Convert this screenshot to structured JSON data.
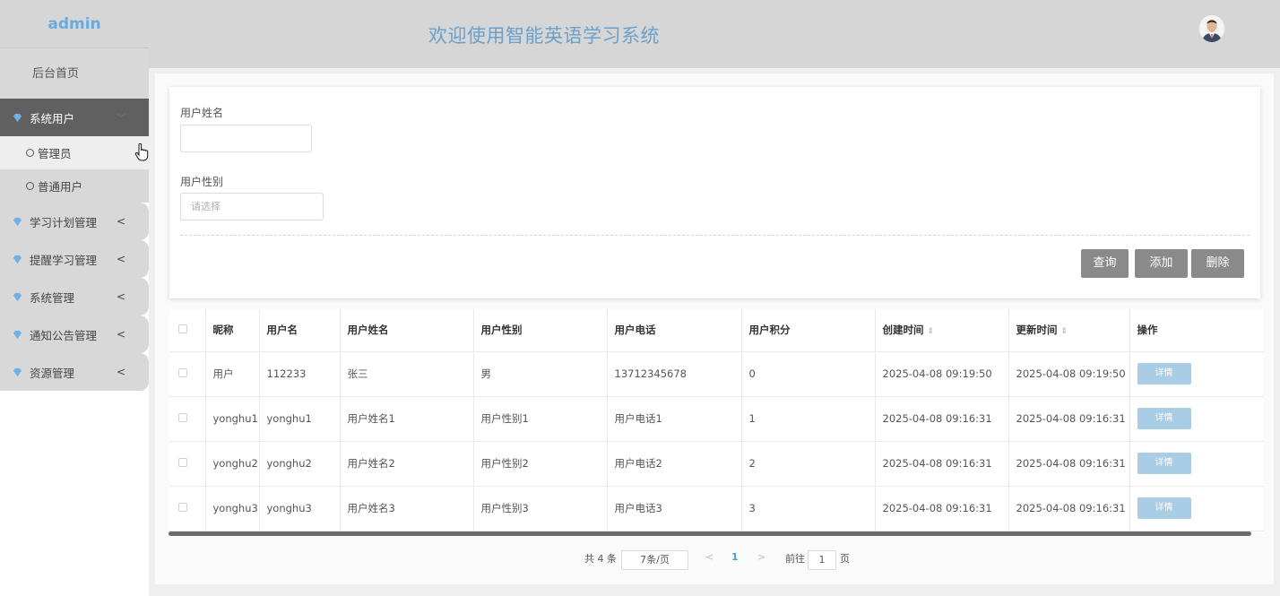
{
  "sidebar": {
    "brand": "admin",
    "home": "后台首页",
    "groups": [
      {
        "label": "系统用户",
        "arrow": "﹀"
      },
      {
        "label": "学习计划管理",
        "arrow": "<"
      },
      {
        "label": "提醒学习管理",
        "arrow": "<"
      },
      {
        "label": "系统管理",
        "arrow": "<"
      },
      {
        "label": "通知公告管理",
        "arrow": "<"
      },
      {
        "label": "资源管理",
        "arrow": "<"
      }
    ],
    "sub_items": [
      {
        "label": "管理员"
      },
      {
        "label": "普通用户"
      }
    ]
  },
  "header": {
    "title": "欢迎使用智能英语学习系统"
  },
  "search": {
    "name_label": "用户姓名",
    "name_value": "",
    "gender_label": "用户性别",
    "gender_placeholder": "请选择",
    "query_label": "查询",
    "add_label": "添加",
    "delete_label": "删除"
  },
  "table": {
    "headers": [
      "昵称",
      "用户名",
      "用户姓名",
      "用户性别",
      "用户电话",
      "用户积分",
      "创建时间",
      "更新时间",
      "操作"
    ],
    "rows": [
      {
        "nickname": "用户",
        "username": "112233",
        "name": "张三",
        "gender": "男",
        "phone": "13712345678",
        "points": "0",
        "created": "2025-04-08 09:19:50",
        "updated": "2025-04-08 09:19:50",
        "action": "详情"
      },
      {
        "nickname": "yonghu1",
        "username": "yonghu1",
        "name": "用户姓名1",
        "gender": "用户性别1",
        "phone": "用户电话1",
        "points": "1",
        "created": "2025-04-08 09:16:31",
        "updated": "2025-04-08 09:16:31",
        "action": "详情"
      },
      {
        "nickname": "yonghu2",
        "username": "yonghu2",
        "name": "用户姓名2",
        "gender": "用户性别2",
        "phone": "用户电话2",
        "points": "2",
        "created": "2025-04-08 09:16:31",
        "updated": "2025-04-08 09:16:31",
        "action": "详情"
      },
      {
        "nickname": "yonghu3",
        "username": "yonghu3",
        "name": "用户姓名3",
        "gender": "用户性别3",
        "phone": "用户电话3",
        "points": "3",
        "created": "2025-04-08 09:16:31",
        "updated": "2025-04-08 09:16:31",
        "action": "详情"
      }
    ]
  },
  "pagination": {
    "total": "共 4 条",
    "page_size": "7条/页",
    "prev": "<",
    "current": "1",
    "next": ">",
    "goto_label": "前往",
    "goto_value": "1",
    "page_unit": "页"
  },
  "colors": {
    "brand": "#6aaadc",
    "active_menu": "#606060",
    "button": "#8a8a8a",
    "detail_button": "#a9cde4",
    "gem": "#6fb0e6"
  },
  "icons": {
    "menu": "gem-icon",
    "sub": "circle-check-icon",
    "cursor": "hand-pointer-icon",
    "avatar": "user-avatar"
  }
}
